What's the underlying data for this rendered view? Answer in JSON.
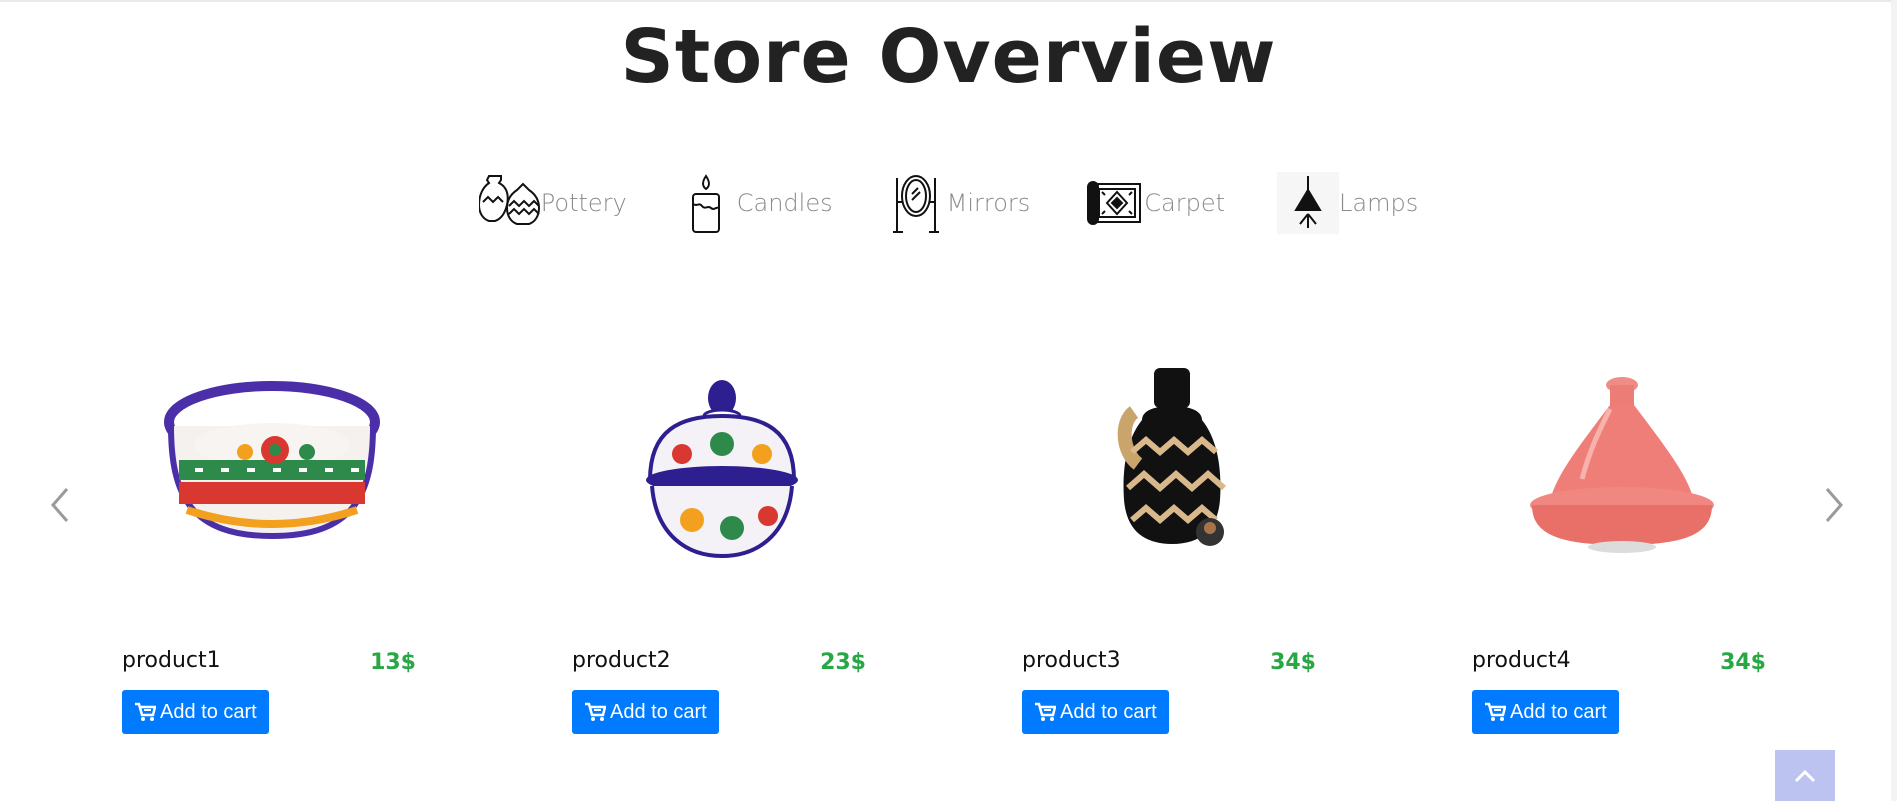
{
  "page": {
    "title": "Store Overview"
  },
  "categories": [
    {
      "label": "Pottery",
      "icon": "pottery-icon"
    },
    {
      "label": "Candles",
      "icon": "candle-icon"
    },
    {
      "label": "Mirrors",
      "icon": "mirror-icon"
    },
    {
      "label": "Carpet",
      "icon": "carpet-icon"
    },
    {
      "label": "Lamps",
      "icon": "lamp-icon"
    }
  ],
  "products": [
    {
      "name": "product1",
      "price": "13$",
      "button_label": "Add to cart",
      "image": "patterned-bowl-image"
    },
    {
      "name": "product2",
      "price": "23$",
      "button_label": "Add to cart",
      "image": "lidded-sugar-pot-image"
    },
    {
      "name": "product3",
      "price": "34$",
      "button_label": "Add to cart",
      "image": "black-jug-image"
    },
    {
      "name": "product4",
      "price": "34$",
      "button_label": "Add to cart",
      "image": "pink-tagine-image"
    }
  ],
  "colors": {
    "accent": "#007bff",
    "price": "#28a745",
    "back_to_top": "#bcc3f0"
  }
}
